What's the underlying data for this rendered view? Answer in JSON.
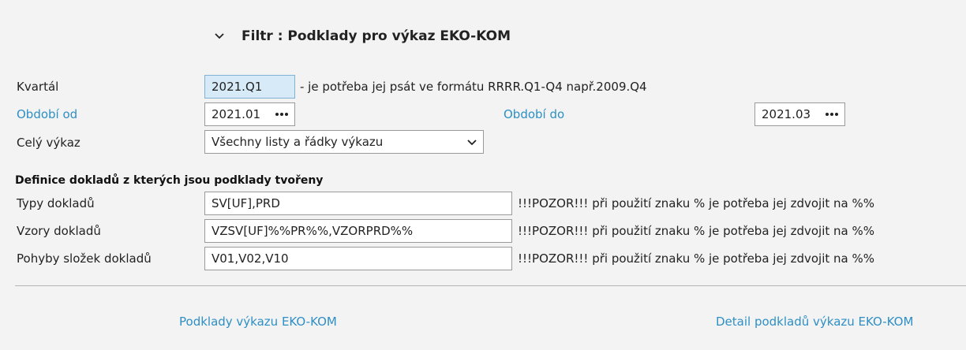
{
  "filter": {
    "title": "Filtr : Podklady pro výkaz EKO-KOM"
  },
  "kvartal": {
    "label": "Kvartál",
    "value": "2021.Q1",
    "hint": "- je potřeba jej psát ve formátu RRRR.Q1-Q4 např.2009.Q4"
  },
  "obdobi_od": {
    "label": "Období od",
    "value": "2021.01"
  },
  "obdobi_do": {
    "label": "Období do",
    "value": "2021.03"
  },
  "cely_vykaz": {
    "label": "Celý výkaz",
    "selected": "Všechny listy a řádky výkazu"
  },
  "definice": {
    "heading": "Definice dokladů z kterých jsou podklady tvořeny",
    "warning": "!!!POZOR!!! při použití znaku % je potřeba jej zdvojit na %%",
    "rows": [
      {
        "label": "Typy dokladů",
        "value": "SV[UF],PRD"
      },
      {
        "label": "Vzory dokladů",
        "value": "VZSV[UF]%%PR%%,VZORPRD%%"
      },
      {
        "label": "Pohyby složek dokladů",
        "value": "V01,V02,V10"
      }
    ]
  },
  "actions": {
    "podklady": "Podklady výkazu EKO-KOM",
    "detail": "Detail podkladů výkazu EKO-KOM"
  }
}
